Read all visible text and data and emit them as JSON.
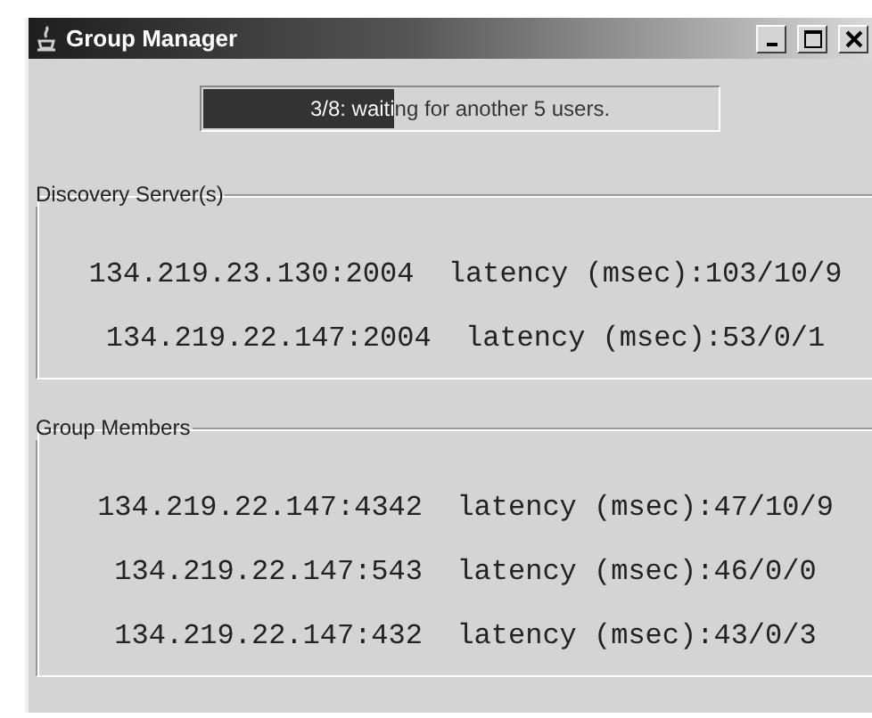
{
  "window": {
    "title": "Group Manager"
  },
  "progress": {
    "text": "3/8: waiting for another 5 users.",
    "level": 0.375
  },
  "discovery_servers": {
    "title": "Discovery Server(s)",
    "rows": [
      "134.219.23.130:2004  latency (msec):103/10/9",
      "134.219.22.147:2004  latency (msec):53/0/1"
    ]
  },
  "group_members": {
    "title": "Group Members",
    "rows": [
      "134.219.22.147:4342  latency (msec):47/10/9",
      "134.219.22.147:543  latency (msec):46/0/0",
      "134.219.22.147:432  latency (msec):43/0/3"
    ]
  }
}
